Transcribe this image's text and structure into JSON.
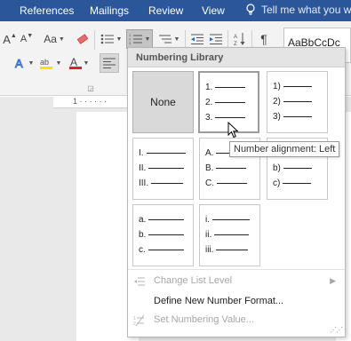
{
  "menubar": {
    "tabs": [
      "References",
      "Mailings",
      "Review",
      "View"
    ],
    "tell_me": "Tell me what you wan",
    "bg": "#2b579a"
  },
  "ribbon": {
    "font_grow": "A",
    "font_shrink": "A",
    "change_case": "Aa",
    "styles_preview": "AaBbCcDc",
    "paragraph_mark": "¶"
  },
  "ruler": {
    "text": "1 · · · · · ·"
  },
  "numbering": {
    "header": "Numbering Library",
    "none_label": "None",
    "tiles": [
      {
        "id": "none"
      },
      {
        "id": "decimal-period",
        "markers": [
          "1.",
          "2.",
          "3."
        ]
      },
      {
        "id": "decimal-paren",
        "markers": [
          "1)",
          "2)",
          "3)"
        ]
      },
      {
        "id": "upper-roman",
        "markers": [
          "I.",
          "II.",
          "III."
        ]
      },
      {
        "id": "upper-alpha-period",
        "markers": [
          "A.",
          "B.",
          "C."
        ]
      },
      {
        "id": "lower-alpha-paren",
        "markers": [
          "a)",
          "b)",
          "c)"
        ]
      },
      {
        "id": "lower-alpha-period",
        "markers": [
          "a.",
          "b.",
          "c."
        ]
      },
      {
        "id": "lower-roman",
        "markers": [
          "i.",
          "ii.",
          "iii."
        ]
      }
    ],
    "commands": {
      "change_list_level": "Change List Level",
      "define_new": "Define New Number Format...",
      "set_value": "Set Numbering Value..."
    }
  },
  "tooltip": "Number alignment: Left"
}
